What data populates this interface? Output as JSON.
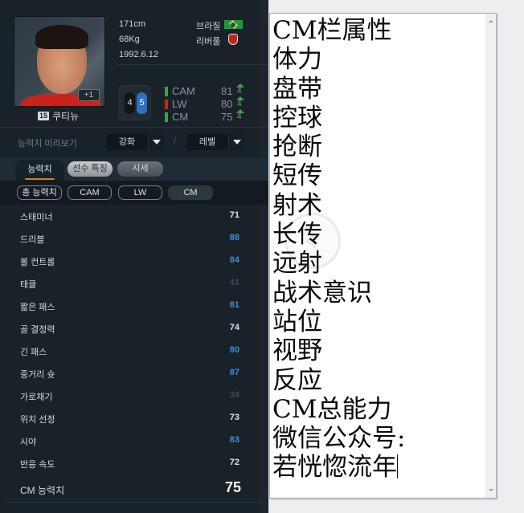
{
  "player": {
    "height": "171cm",
    "weight": "68Kg",
    "birthdate": "1992.6.12",
    "nation": "브라질",
    "nation_flag_icon": "brazil-flag-icon",
    "club": "리버풀",
    "club_crest_icon": "liverpool-crest-icon",
    "jersey_number": "15",
    "name": "쿠티뉴",
    "enhance_badge": "+1",
    "weak_foot_left": "4",
    "weak_foot_right": "5"
  },
  "positions": [
    {
      "name": "CAM",
      "value": "81",
      "boost": "4",
      "color": "#3aa548"
    },
    {
      "name": "LW",
      "value": "80",
      "boost": "4",
      "color": "#c8241e"
    },
    {
      "name": "CM",
      "value": "75",
      "boost": "4",
      "color": "#3aa548"
    }
  ],
  "preview": {
    "label": "능력치 미리보기",
    "enhance_dropdown": "강화",
    "level_dropdown": "레벨",
    "separator": "/"
  },
  "tabs": [
    {
      "label": "능력치",
      "active": true
    },
    {
      "label": "선수 특징",
      "active": false
    },
    {
      "label": "시세",
      "active": false
    }
  ],
  "filters": [
    {
      "label": "총 능력치",
      "selected": false
    },
    {
      "label": "CAM",
      "selected": false
    },
    {
      "label": "LW",
      "selected": false
    },
    {
      "label": "CM",
      "selected": true
    }
  ],
  "stats": [
    {
      "label": "스태미너",
      "value": "71",
      "tier": "normal"
    },
    {
      "label": "드리블",
      "value": "88",
      "tier": "high"
    },
    {
      "label": "볼 컨트롤",
      "value": "84",
      "tier": "high"
    },
    {
      "label": "태클",
      "value": "41",
      "tier": "low"
    },
    {
      "label": "짧은 패스",
      "value": "81",
      "tier": "high"
    },
    {
      "label": "골 결정력",
      "value": "74",
      "tier": "normal"
    },
    {
      "label": "긴 패스",
      "value": "80",
      "tier": "high"
    },
    {
      "label": "중거리 슛",
      "value": "87",
      "tier": "high"
    },
    {
      "label": "가로채기",
      "value": "34",
      "tier": "low"
    },
    {
      "label": "위치 선정",
      "value": "73",
      "tier": "normal"
    },
    {
      "label": "시야",
      "value": "83",
      "tier": "high"
    },
    {
      "label": "반응 속도",
      "value": "72",
      "tier": "normal"
    }
  ],
  "overall": {
    "label": "CM 능력치",
    "value": "75"
  },
  "editor": {
    "lines": [
      "CM栏属性",
      "体力",
      "盘带",
      "控球",
      "抢断",
      "短传",
      "射术",
      "长传",
      "远射",
      "战术意识",
      "站位",
      "视野",
      "反应",
      "CM总能力",
      "微信公众号:",
      "若恍惚流年"
    ]
  },
  "colors": {
    "stat_high": "#3d8fd6",
    "stat_normal": "#dfe3e6",
    "stat_low": "#41494f",
    "tab_underline": "#e07a18",
    "panel_bg": "#1a2229"
  }
}
